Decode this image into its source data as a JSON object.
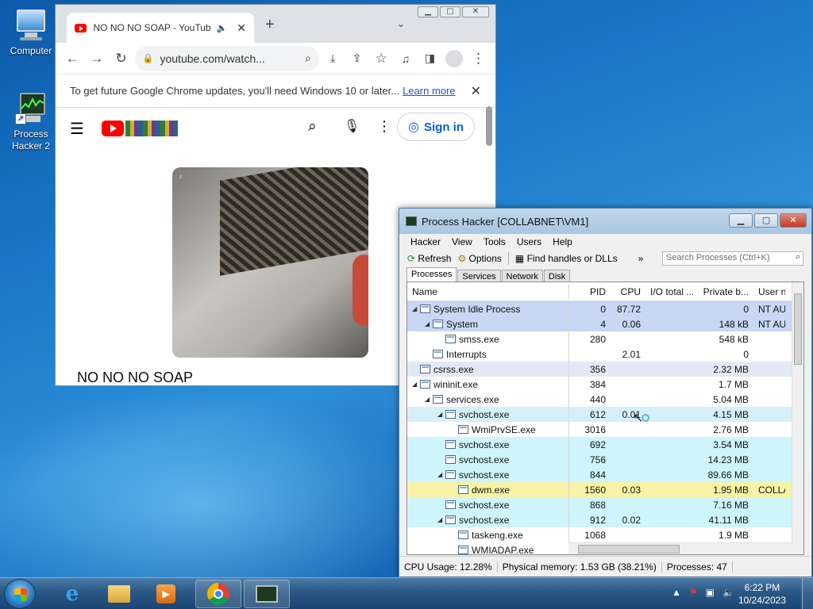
{
  "desktop": {
    "icons": [
      {
        "label": "Computer"
      },
      {
        "label": "Process Hacker 2"
      }
    ]
  },
  "chrome": {
    "tab_title": "NO NO NO SOAP - YouTube",
    "url": "youtube.com/watch...",
    "infobar_text": "To get future Google Chrome updates, you'll need Windows 10 or later...",
    "infobar_link": "Learn more",
    "signin_label": "Sign in",
    "video_title": "NO NO NO SOAP"
  },
  "process_hacker": {
    "title": "Process Hacker [COLLABNET\\VM1]",
    "menu": [
      "Hacker",
      "View",
      "Tools",
      "Users",
      "Help"
    ],
    "toolbar": {
      "refresh": "Refresh",
      "options": "Options",
      "find": "Find handles or DLLs",
      "overflow": "»"
    },
    "search_placeholder": "Search Processes (Ctrl+K)",
    "tabs": [
      "Processes",
      "Services",
      "Network",
      "Disk"
    ],
    "columns": [
      "Name",
      "PID",
      "CPU",
      "I/O total ...",
      "Private b...",
      "User na"
    ],
    "rows": [
      {
        "name": "System Idle Process",
        "pid": "0",
        "cpu": "87.72",
        "private": "0",
        "user": "NT AUT",
        "depth": 0,
        "expander": true,
        "color": "#c7d7f4"
      },
      {
        "name": "System",
        "pid": "4",
        "cpu": "0.06",
        "private": "148 kB",
        "user": "NT AUT",
        "depth": 1,
        "expander": true,
        "color": "#c7d7f4"
      },
      {
        "name": "smss.exe",
        "pid": "280",
        "cpu": "",
        "private": "548 kB",
        "user": "",
        "depth": 2,
        "expander": false,
        "color": "#ffffff"
      },
      {
        "name": "Interrupts",
        "pid": "",
        "cpu": "2.01",
        "private": "0",
        "user": "",
        "depth": 1,
        "expander": false,
        "color": "#ffffff"
      },
      {
        "name": "csrss.exe",
        "pid": "356",
        "cpu": "",
        "private": "2.32 MB",
        "user": "",
        "depth": 0,
        "expander": false,
        "color": "#e2e9f5"
      },
      {
        "name": "wininit.exe",
        "pid": "384",
        "cpu": "",
        "private": "1.7 MB",
        "user": "",
        "depth": 0,
        "expander": true,
        "color": "#ffffff"
      },
      {
        "name": "services.exe",
        "pid": "440",
        "cpu": "",
        "private": "5.04 MB",
        "user": "",
        "depth": 1,
        "expander": true,
        "color": "#ffffff"
      },
      {
        "name": "svchost.exe",
        "pid": "612",
        "cpu": "0.01",
        "private": "4.15 MB",
        "user": "",
        "depth": 2,
        "expander": true,
        "color": "#d6f0fa"
      },
      {
        "name": "WmiPrvSE.exe",
        "pid": "3016",
        "cpu": "",
        "private": "2.76 MB",
        "user": "",
        "depth": 3,
        "expander": false,
        "color": "#ffffff"
      },
      {
        "name": "svchost.exe",
        "pid": "692",
        "cpu": "",
        "private": "3.54 MB",
        "user": "",
        "depth": 2,
        "expander": false,
        "color": "#cdf5fb"
      },
      {
        "name": "svchost.exe",
        "pid": "756",
        "cpu": "",
        "private": "14.23 MB",
        "user": "",
        "depth": 2,
        "expander": false,
        "color": "#cdf5fb"
      },
      {
        "name": "svchost.exe",
        "pid": "844",
        "cpu": "",
        "private": "89.66 MB",
        "user": "",
        "depth": 2,
        "expander": true,
        "color": "#cdf5fb"
      },
      {
        "name": "dwm.exe",
        "pid": "1560",
        "cpu": "0.03",
        "private": "1.95 MB",
        "user": "COLLA",
        "depth": 3,
        "expander": false,
        "color": "#f8f2a6"
      },
      {
        "name": "svchost.exe",
        "pid": "868",
        "cpu": "",
        "private": "7.16 MB",
        "user": "",
        "depth": 2,
        "expander": false,
        "color": "#cdf5fb"
      },
      {
        "name": "svchost.exe",
        "pid": "912",
        "cpu": "0.02",
        "private": "41.11 MB",
        "user": "",
        "depth": 2,
        "expander": true,
        "color": "#cdf5fb"
      },
      {
        "name": "taskeng.exe",
        "pid": "1068",
        "cpu": "",
        "private": "1.9 MB",
        "user": "",
        "depth": 3,
        "expander": false,
        "color": "#ffffff"
      },
      {
        "name": "WMIADAP.exe",
        "pid": "",
        "cpu": "",
        "private": "",
        "user": "",
        "depth": 3,
        "expander": false,
        "color": "#ffffff"
      }
    ],
    "status": {
      "cpu": "CPU Usage: 12.28%",
      "memory": "Physical memory: 1.53 GB (38.21%)",
      "processes": "Processes: 47"
    }
  },
  "taskbar": {
    "time": "6:22 PM",
    "date": "10/24/2023"
  }
}
